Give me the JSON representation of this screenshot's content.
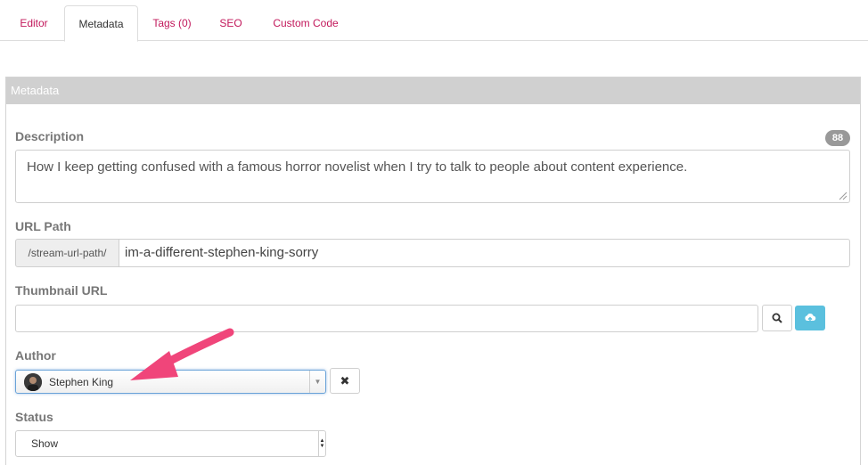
{
  "tabs": [
    {
      "label": "Editor",
      "active": false
    },
    {
      "label": "Metadata",
      "active": true
    },
    {
      "label": "Tags (0)",
      "active": false
    },
    {
      "label": "SEO",
      "active": false
    },
    {
      "label": "Custom Code",
      "active": false
    }
  ],
  "panel": {
    "title": "Metadata"
  },
  "description": {
    "label": "Description",
    "count": "88",
    "value": "How I keep getting confused with a famous horror novelist when I try to talk to people about content experience."
  },
  "url_path": {
    "label": "URL Path",
    "prefix": "/stream-url-path/",
    "value": "im-a-different-stephen-king-sorry"
  },
  "thumbnail": {
    "label": "Thumbnail URL",
    "value": ""
  },
  "author": {
    "label": "Author",
    "selected": "Stephen King"
  },
  "status": {
    "label": "Status",
    "selected": "Show"
  },
  "icons": {
    "search": "search-icon",
    "upload": "cloud-upload-icon",
    "clear": "close-icon",
    "arrow": "arrow-annotation-icon"
  },
  "colors": {
    "tab_link": "#c2185b",
    "panel_header": "#d0d0d0",
    "upload_button": "#5bc0de",
    "badge": "#999999",
    "annotation_arrow": "#f0457a"
  }
}
